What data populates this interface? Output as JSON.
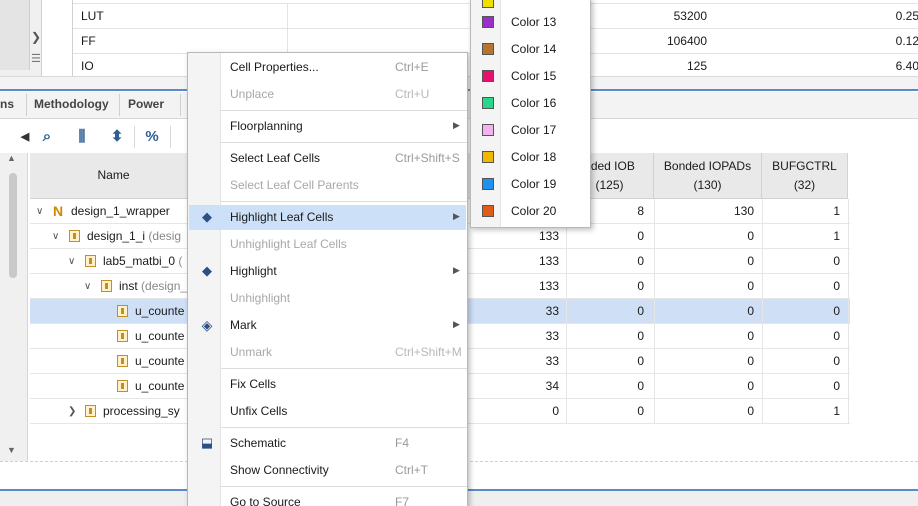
{
  "colors": {
    "accent": "#5b8ac8",
    "selection": "#cfe0f6",
    "menu_highlight": "#cce0f8"
  },
  "util_table": {
    "rows": [
      {
        "name": "LUT",
        "available": "53200",
        "pct": "0.25"
      },
      {
        "name": "FF",
        "available": "106400",
        "pct": "0.12"
      },
      {
        "name": "IO",
        "available": "125",
        "pct": "6.40"
      }
    ]
  },
  "tabs": [
    {
      "label": "ns"
    },
    {
      "label": "Methodology"
    },
    {
      "label": "Power"
    }
  ],
  "toolbar": {
    "icons": [
      "collapse-arrow-icon",
      "search-icon",
      "collapse-all-icon",
      "expand-all-icon",
      "percent-icon"
    ]
  },
  "hier": {
    "headers": {
      "name": "Name",
      "bonded_iob": "nded IOB\n(125)",
      "bonded_iopads": "Bonded IOPADs\n(130)",
      "bufgctrl": "BUFGCTRL\n(32)"
    },
    "rows": [
      {
        "name": "design_1_wrapper",
        "sub": "",
        "c1": "",
        "iob": "8",
        "iopads": "130",
        "bufg": "1"
      },
      {
        "name": "design_1_i",
        "sub": " (desig",
        "c1": "133",
        "iob": "0",
        "iopads": "0",
        "bufg": "1"
      },
      {
        "name": "lab5_matbi_0",
        "sub": " (",
        "c1": "133",
        "iob": "0",
        "iopads": "0",
        "bufg": "0"
      },
      {
        "name": "inst",
        "sub": " (design_",
        "c1": "133",
        "iob": "0",
        "iopads": "0",
        "bufg": "0"
      },
      {
        "name": "u_counte",
        "sub": "",
        "c1": "33",
        "iob": "0",
        "iopads": "0",
        "bufg": "0"
      },
      {
        "name": "u_counte",
        "sub": "",
        "c1": "33",
        "iob": "0",
        "iopads": "0",
        "bufg": "0"
      },
      {
        "name": "u_counte",
        "sub": "",
        "c1": "33",
        "iob": "0",
        "iopads": "0",
        "bufg": "0"
      },
      {
        "name": "u_counte",
        "sub": "",
        "c1": "34",
        "iob": "0",
        "iopads": "0",
        "bufg": "0"
      },
      {
        "name": "processing_sy",
        "sub": "",
        "c1": "0",
        "iob": "0",
        "iopads": "0",
        "bufg": "1"
      }
    ]
  },
  "context_menu": {
    "items": [
      {
        "label": "Cell Properties...",
        "shortcut": "Ctrl+E"
      },
      {
        "label": "Unplace",
        "shortcut": "Ctrl+U"
      },
      {
        "label": "Floorplanning",
        "shortcut": ""
      },
      {
        "label": "Select Leaf Cells",
        "shortcut": "Ctrl+Shift+S"
      },
      {
        "label": "Select Leaf Cell Parents",
        "shortcut": ""
      },
      {
        "label": "Highlight Leaf Cells",
        "shortcut": ""
      },
      {
        "label": "Unhighlight Leaf Cells",
        "shortcut": ""
      },
      {
        "label": "Highlight",
        "shortcut": ""
      },
      {
        "label": "Unhighlight",
        "shortcut": ""
      },
      {
        "label": "Mark",
        "shortcut": ""
      },
      {
        "label": "Unmark",
        "shortcut": "Ctrl+Shift+M"
      },
      {
        "label": "Fix Cells",
        "shortcut": ""
      },
      {
        "label": "Unfix Cells",
        "shortcut": ""
      },
      {
        "label": "Schematic",
        "shortcut": "F4"
      },
      {
        "label": "Show Connectivity",
        "shortcut": "Ctrl+T"
      },
      {
        "label": "Go to Source",
        "shortcut": "F7"
      }
    ]
  },
  "color_menu": {
    "items": [
      {
        "label": "Color 13",
        "color": "#9b30c8"
      },
      {
        "label": "Color 14",
        "color": "#b8732f"
      },
      {
        "label": "Color 15",
        "color": "#e8106e"
      },
      {
        "label": "Color 16",
        "color": "#28d68a"
      },
      {
        "label": "Color 17",
        "color": "#f2b3f0"
      },
      {
        "label": "Color 18",
        "color": "#f2b800"
      },
      {
        "label": "Color 19",
        "color": "#1e90f0"
      },
      {
        "label": "Color 20",
        "color": "#e05a18"
      }
    ],
    "partial_top_color": "#f0e000"
  }
}
